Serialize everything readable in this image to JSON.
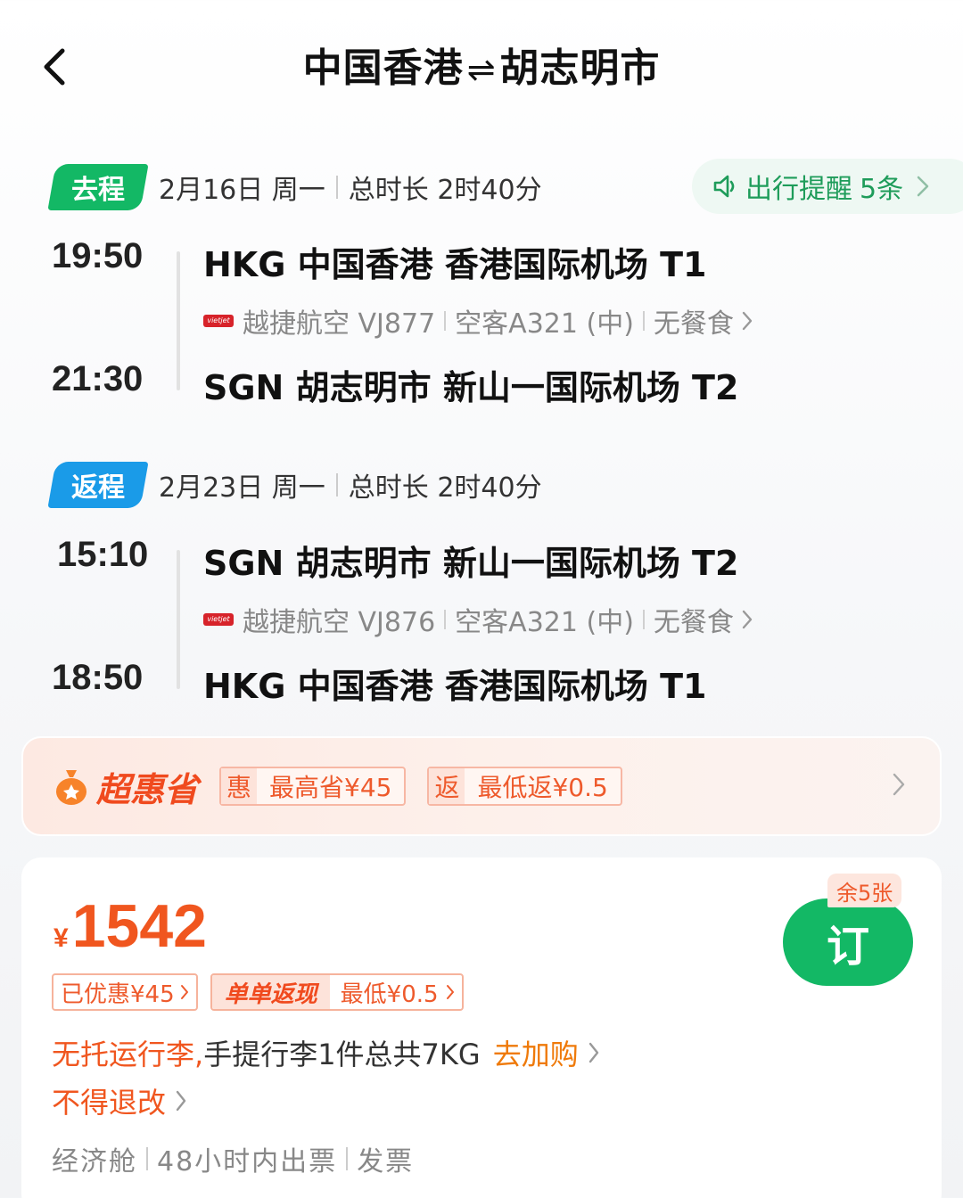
{
  "header": {
    "title_from": "中国香港",
    "title_arrows": "⇌",
    "title_to": "胡志明市"
  },
  "reminder": {
    "label": "出行提醒",
    "count": "5条"
  },
  "outbound": {
    "tag": "去程",
    "date": "2月16日 周一",
    "duration": "总时长 2时40分",
    "dep_time": "19:50",
    "dep_airport": "HKG 中国香港 香港国际机场 T1",
    "airline": "越捷航空 VJ877",
    "aircraft": "空客A321 (中)",
    "meal": "无餐食",
    "arr_time": "21:30",
    "arr_airport": "SGN 胡志明市 新山一国际机场 T2"
  },
  "return": {
    "tag": "返程",
    "date": "2月23日 周一",
    "duration": "总时长 2时40分",
    "dep_time": "15:10",
    "dep_airport": "SGN 胡志明市 新山一国际机场 T2",
    "airline": "越捷航空 VJ876",
    "aircraft": "空客A321 (中)",
    "meal": "无餐食",
    "arr_time": "18:50",
    "arr_airport": "HKG 中国香港 香港国际机场 T1"
  },
  "promo": {
    "brand": "超惠省",
    "badge1_key": "惠",
    "badge1_value": "最高省¥45",
    "badge2_key": "返",
    "badge2_value": "最低返¥0.5"
  },
  "offer": {
    "currency": "¥",
    "price": "1542",
    "remaining": "余5张",
    "book_label": "订",
    "discount_chip": "已优惠¥45",
    "cashback_label": "单单返现",
    "cashback_value": "最低¥0.5",
    "baggage_warning": "无托运行李,",
    "baggage_detail": "手提行李1件总共7KG",
    "baggage_action": "去加购",
    "refund_rule": "不得退改",
    "cabin": "经济舱",
    "ticketing": "48小时内出票",
    "invoice": "发票"
  },
  "colors": {
    "green": "#13b865",
    "blue": "#1a9be8",
    "orange": "#f0561f",
    "action_orange": "#ef7a0a"
  },
  "icons": {
    "back": "chevron-left-icon",
    "reminder": "speaker-icon",
    "chevron": "chevron-right-icon",
    "promo": "money-bag-icon",
    "airline": "vietjet-logo"
  }
}
